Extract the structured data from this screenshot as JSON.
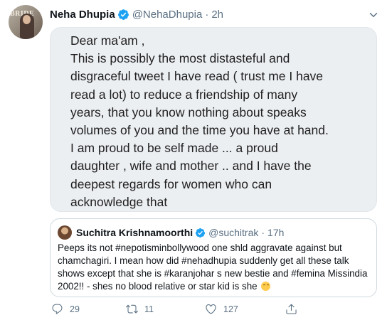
{
  "colors": {
    "accent": "#1da1f2",
    "secondary_text": "#5b7083",
    "card_background": "#eceff2"
  },
  "tweet": {
    "avatar_text": "BRIDE",
    "display_name": "Neha Dhupia",
    "handle": "@NehaDhupia",
    "separator": "·",
    "time": "2h",
    "verified_icon": "verified-badge-icon",
    "menu_icon": "chevron-down-icon",
    "image_text": [
      "Dear ma'am ,",
      "This is possibly the most distasteful and",
      "disgraceful tweet I have read ( trust me I have",
      "read a lot) to reduce a friendship of many",
      "years, that you know nothing about speaks",
      "volumes of you and the time you have at hand.",
      "I am proud to be self made ... a proud",
      "daughter , wife and mother .. and I have the",
      "deepest regards for women who can",
      "acknowledge that"
    ]
  },
  "quoted_tweet": {
    "display_name": "Suchitra Krishnamoorthi",
    "handle": "@suchitrak",
    "separator": "·",
    "time": "17h",
    "text_lines": [
      "Peeps its not #nepotisminbollywood one shld aggravate against but",
      "chamchagiri. I mean how did #nehadhupia suddenly get all these talk",
      "shows except that she is #karanjohar s new bestie and #femina Missindia",
      "2002!! - shes no blood relative or star kid is she"
    ],
    "emoji": "smiling-face-icon"
  },
  "actions": {
    "reply_count": "29",
    "retweet_count": "11",
    "like_count": "127"
  }
}
